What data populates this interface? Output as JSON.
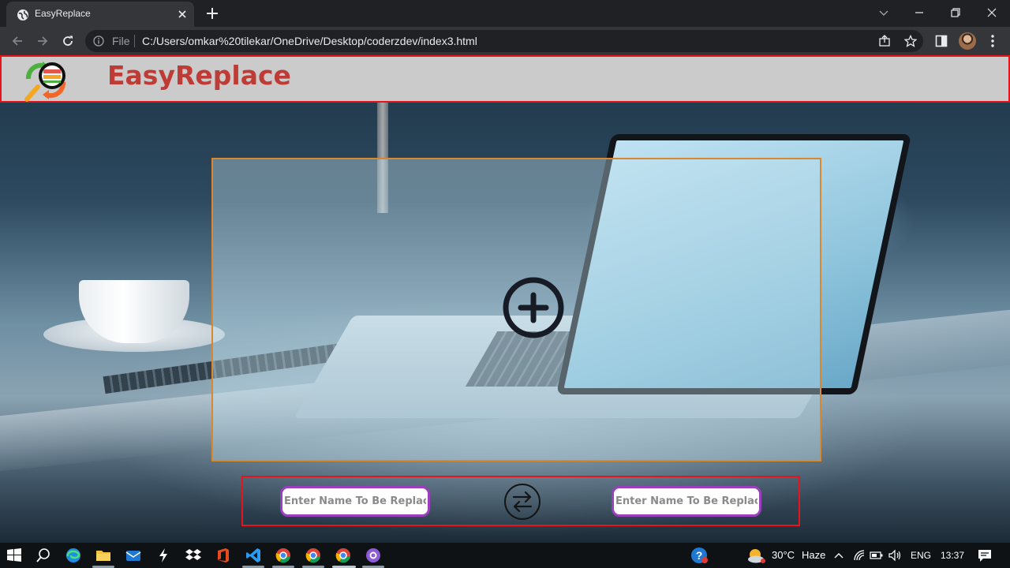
{
  "browser": {
    "tab_title": "EasyReplace",
    "omnibox": {
      "scheme_label": "File",
      "url": "C:/Users/omkar%20tilekar/OneDrive/Desktop/coderzdev/index3.html"
    }
  },
  "site": {
    "brand": "EasyReplace",
    "inputs": {
      "left_placeholder": "Enter Name To Be Replaced",
      "right_placeholder": "Enter Name To Be Replaced"
    },
    "colors": {
      "header_bg": "#cbcbcb",
      "header_border": "#e8141c",
      "brand_text": "#bf3b35",
      "upload_border": "#d9882d",
      "input_border": "#9b3fbf",
      "control_border": "#e8141c"
    }
  },
  "taskbar": {
    "weather_temp": "30°C",
    "weather_desc": "Haze",
    "language": "ENG",
    "time": "13:37",
    "pinned_apps": [
      "windows-icon",
      "search-icon",
      "edge-icon",
      "file-explorer-icon",
      "mail-icon",
      "winamp-icon",
      "dropbox-icon",
      "office-icon",
      "vscode-icon",
      "chrome-icon",
      "chrome-icon",
      "chrome-icon",
      "github-desktop-icon"
    ]
  }
}
